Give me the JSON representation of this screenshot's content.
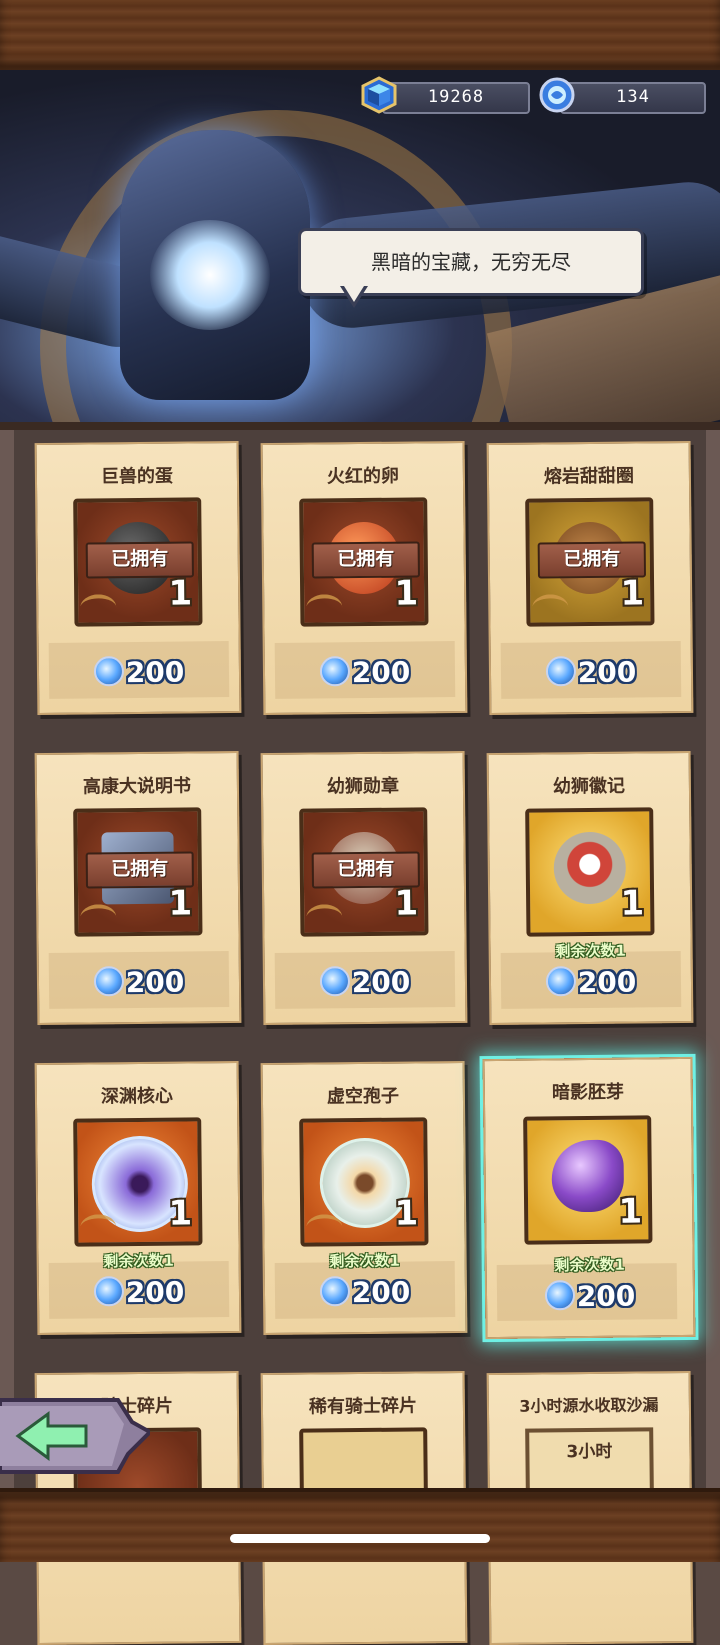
{
  "header": {
    "gem_count": "19268",
    "coin_count": "134"
  },
  "banner": {
    "speech": "黑暗的宝藏，无穷无尽"
  },
  "owned_label": "已拥有",
  "items": [
    {
      "name": "巨兽的蛋",
      "owned": true,
      "quantity": "1",
      "price": "200"
    },
    {
      "name": "火红的卵",
      "owned": true,
      "quantity": "1",
      "price": "200"
    },
    {
      "name": "熔岩甜甜圈",
      "owned": true,
      "quantity": "1",
      "price": "200"
    },
    {
      "name": "高康大说明书",
      "owned": true,
      "quantity": "1",
      "price": "200"
    },
    {
      "name": "幼狮勋章",
      "owned": true,
      "quantity": "1",
      "price": "200"
    },
    {
      "name": "幼狮徽记",
      "owned": false,
      "quantity": "1",
      "remaining": "剩余次数1",
      "price": "200"
    },
    {
      "name": "深渊核心",
      "owned": false,
      "quantity": "1",
      "remaining": "剩余次数1",
      "price": "200"
    },
    {
      "name": "虚空孢子",
      "owned": false,
      "quantity": "1",
      "remaining": "剩余次数1",
      "price": "200"
    },
    {
      "name": "暗影胚芽",
      "owned": false,
      "quantity": "1",
      "remaining": "剩余次数1",
      "price": "200",
      "selected": true
    },
    {
      "name": "骑士碎片"
    },
    {
      "name": "稀有骑士碎片"
    },
    {
      "name": "3小时源水收取沙漏",
      "box_text": "3小时"
    }
  ],
  "colors": {
    "highlight": "#6ff0e4",
    "parchment": "#f6e3bd",
    "price_outline": "#1e3a6a"
  }
}
